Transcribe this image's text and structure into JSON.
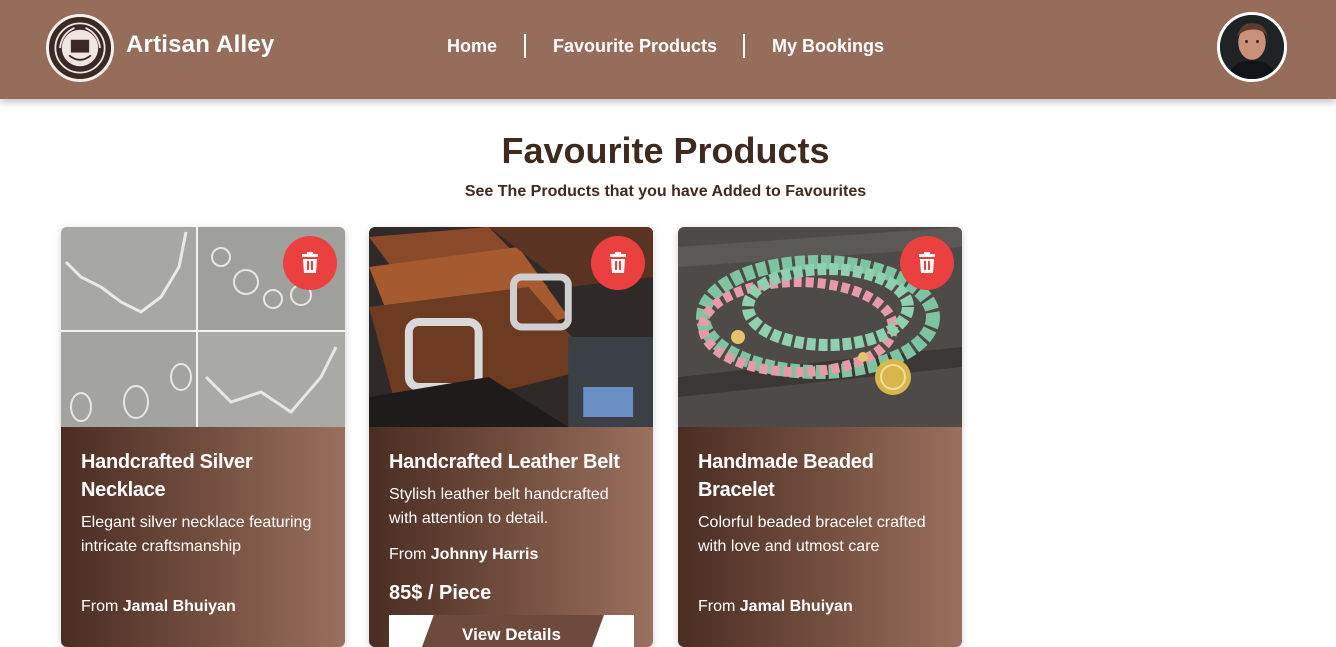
{
  "brand": {
    "name": "Artisan Alley"
  },
  "nav": {
    "items": [
      "Home",
      "Favourite Products",
      "My Bookings"
    ]
  },
  "page": {
    "title": "Favourite Products",
    "subtitle": "See The Products that you have Added to Favourites"
  },
  "cards": [
    {
      "title": "Handcrafted Silver Necklace",
      "description": "Elegant silver necklace featuring intricate craftsmanship",
      "from_label": "From",
      "artisan": "Jamal Bhuiyan"
    },
    {
      "title": "Handcrafted Leather Belt",
      "description": "Stylish leather belt handcrafted with attention to detail.",
      "from_label": "From",
      "artisan": "Johnny Harris",
      "price": "85$ / Piece",
      "button": "View Details"
    },
    {
      "title": "Handmade Beaded Bracelet",
      "description": "Colorful beaded bracelet crafted with love and utmost care",
      "from_label": "From",
      "artisan": "Jamal Bhuiyan"
    }
  ],
  "colors": {
    "header": "#966c5a",
    "heading_text": "#3f2a20",
    "delete_button": "#ea4040",
    "card_gradient_dark": "#4a2d22",
    "card_gradient_light": "#9a705e"
  },
  "icons": {
    "delete": "trash-icon",
    "logo": "logo-emblem",
    "avatar": "user-avatar"
  }
}
